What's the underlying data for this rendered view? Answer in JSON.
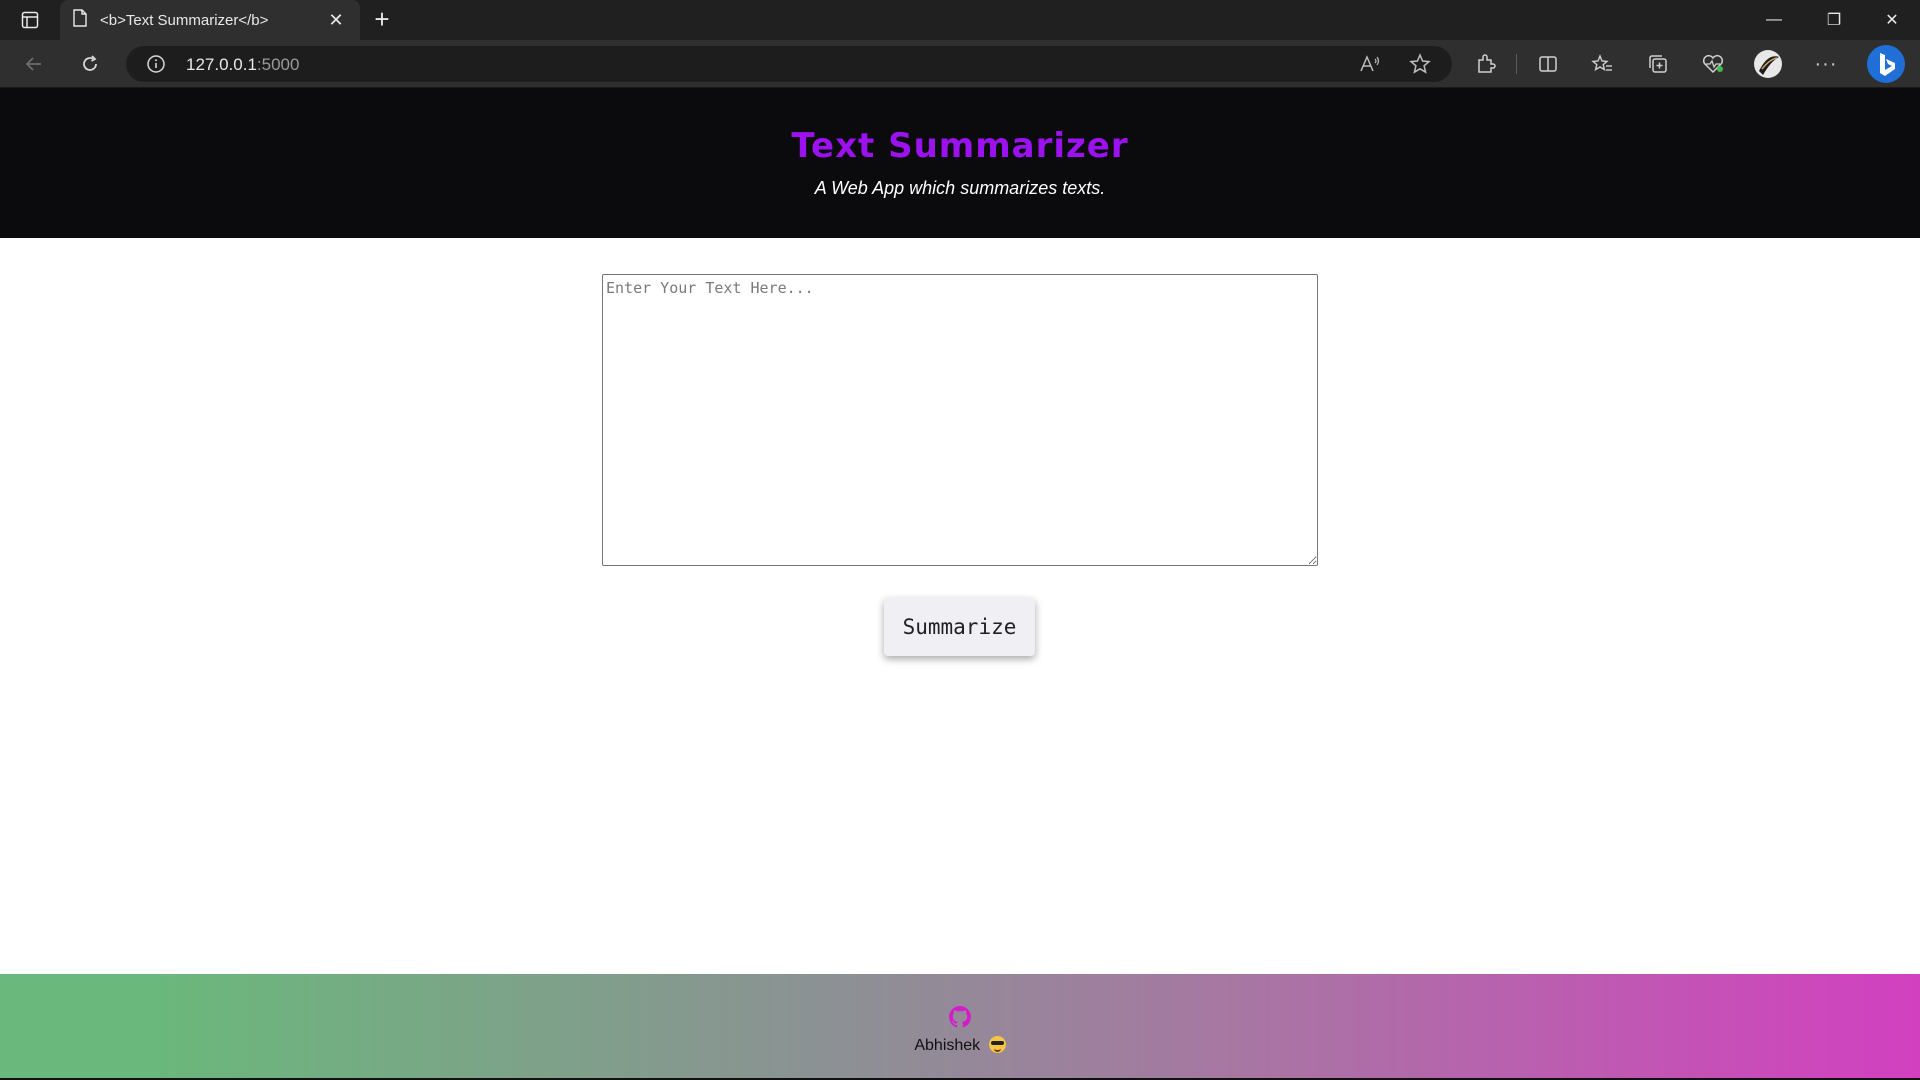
{
  "browser": {
    "tab_title": "<b>Text Summarizer</b>",
    "url_host": "127.0.0.1",
    "url_port": ":5000",
    "new_tab_symbol": "+",
    "close_tab_symbol": "✕",
    "more_symbol": "···",
    "window_controls": {
      "minimize": "—",
      "restore": "❐",
      "close": "✕"
    }
  },
  "hero": {
    "title": "Text Summarizer",
    "subtitle": "A Web App which summarizes texts.",
    "title_color": "#9b11f0",
    "background": "#0b0a0c"
  },
  "form": {
    "textarea_placeholder": "Enter Your Text Here...",
    "textarea_value": "",
    "submit_label": "Summarize"
  },
  "footer": {
    "author": "Abhishek",
    "icon": "github-icon",
    "emoji": "cool-face-emoji",
    "gradient_colors": [
      "#6ab87b",
      "#8e8f95",
      "#a876a3",
      "#d240c0"
    ],
    "icon_color": "#d41cc8"
  }
}
